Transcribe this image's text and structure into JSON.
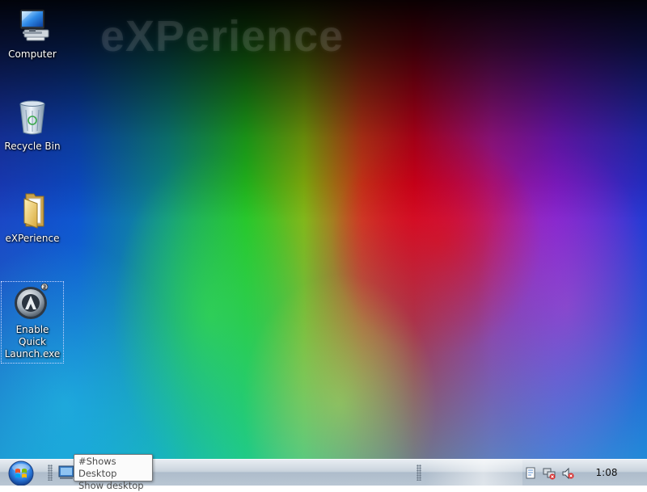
{
  "desktop": {
    "wallpaper_brand": "eXPerience",
    "icons": [
      {
        "label": "Computer",
        "icon": "computer-icon"
      },
      {
        "label": "Recycle Bin",
        "icon": "recycle-bin-icon"
      },
      {
        "label": "eXPerience",
        "icon": "folder-icon"
      },
      {
        "label": "Enable Quick Launch.exe",
        "icon": "app-icon",
        "selected": true
      }
    ]
  },
  "taskbar": {
    "start_button": "start-orb",
    "quick_launch": [
      {
        "name": "Show desktop",
        "icon": "show-desktop-icon"
      }
    ],
    "tray_icons": [
      "action-center-icon",
      "network-icon",
      "volume-muted-icon"
    ],
    "clock": "1:08"
  },
  "tooltip": {
    "line1": "#Shows Desktop",
    "line2": "Show desktop"
  },
  "colors": {
    "taskbar_top": "#e8edf2",
    "taskbar_bottom": "#b9c6d3",
    "start_orb": "#2a7de1"
  }
}
